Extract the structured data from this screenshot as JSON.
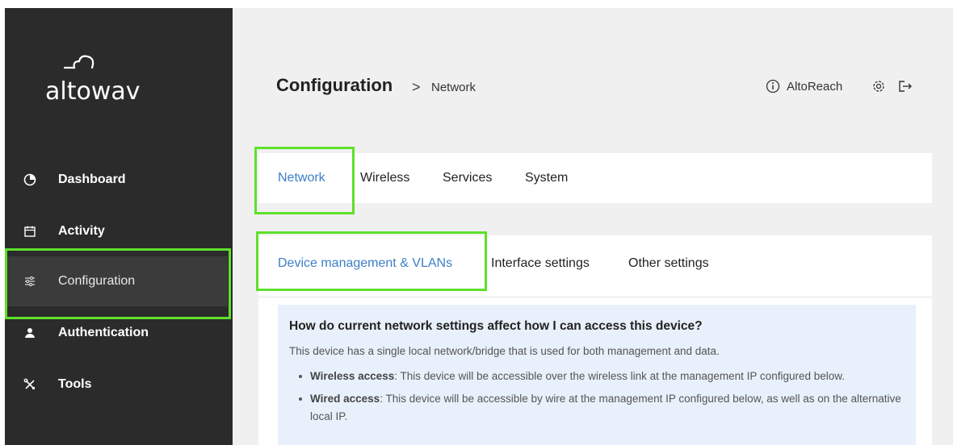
{
  "brand": {
    "logo_text": "altowav"
  },
  "sidebar": {
    "items": [
      {
        "label": "Dashboard",
        "icon": "pie-chart-icon"
      },
      {
        "label": "Activity",
        "icon": "calendar-icon"
      },
      {
        "label": "Configuration",
        "icon": "sliders-icon",
        "active": true
      },
      {
        "label": "Authentication",
        "icon": "user-icon"
      },
      {
        "label": "Tools",
        "icon": "tools-icon"
      }
    ]
  },
  "header": {
    "title": "Configuration",
    "separator": ">",
    "crumb": "Network",
    "user": "AltoReach"
  },
  "tabs": [
    {
      "label": "Network",
      "active": true
    },
    {
      "label": "Wireless"
    },
    {
      "label": "Services"
    },
    {
      "label": "System"
    }
  ],
  "subtabs": [
    {
      "label": "Device management & VLANs",
      "active": true
    },
    {
      "label": "Interface settings"
    },
    {
      "label": "Other settings"
    }
  ],
  "info": {
    "title": "How do current network settings affect how I can access this device?",
    "text": "This device has a single local network/bridge that is used for both management and data.",
    "bullets": [
      {
        "bold": "Wireless access",
        "rest": ": This device will be accessible over the wireless link at the management IP configured below."
      },
      {
        "bold": "Wired access",
        "rest": ": This device will be accessible by wire at the management IP configured below, as well as on the alternative local IP."
      }
    ]
  },
  "colors": {
    "accent": "#3c7fc6",
    "highlight": "#5ee02c",
    "sidebar_bg": "#2b2b2b"
  }
}
